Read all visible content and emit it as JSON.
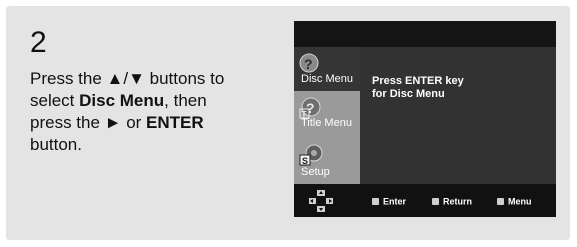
{
  "step": "2",
  "instructions": {
    "line1_prefix": "Press the ",
    "line1_arrows": "▲/▼",
    "line1_suffix": " buttons to",
    "line2_prefix": "select ",
    "line2_bold": "Disc Menu",
    "line2_suffix": ", then",
    "line3_prefix": "press the ",
    "line3_arrow": "►",
    "line3_mid": " or ",
    "line3_bold": "ENTER",
    "line4": "button."
  },
  "osd": {
    "menu_items": [
      {
        "label": "Disc Menu",
        "state": "selected"
      },
      {
        "label": "Title Menu",
        "state": "normal"
      },
      {
        "label": "Setup",
        "state": "normal"
      }
    ],
    "message_line1": "Press ENTER key",
    "message_line2": "for Disc Menu",
    "footer": {
      "enter_label": "Enter",
      "return_label": "Return",
      "menu_label": "Menu"
    },
    "colors": {
      "osd_bg": "#3a3a3a",
      "selected_item_bg": "#353535",
      "unselected_item_bg": "#9a9a9a",
      "footer_bg": "#111111"
    }
  }
}
